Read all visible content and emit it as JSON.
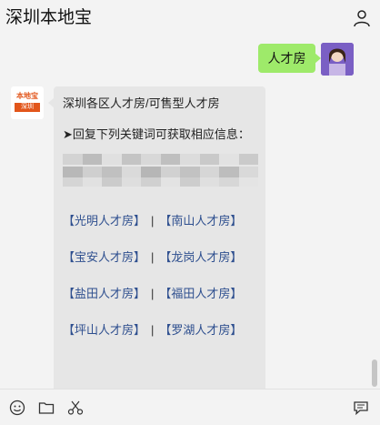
{
  "header": {
    "title": "深圳本地宝"
  },
  "outgoing": {
    "text": "人才房"
  },
  "incoming": {
    "avatar": {
      "logo_top": "本地宝",
      "logo_bottom": "深圳"
    },
    "heading": "深圳各区人才房/可售型人才房",
    "instruction": "➤回复下列关键词可获取相应信息：",
    "links": [
      {
        "left": "【光明人才房】",
        "sep": "|",
        "right": "【南山人才房】"
      },
      {
        "left": "【宝安人才房】",
        "sep": "|",
        "right": "【龙岗人才房】"
      },
      {
        "left": "【盐田人才房】",
        "sep": "|",
        "right": "【福田人才房】"
      },
      {
        "left": "【坪山人才房】",
        "sep": "|",
        "right": "【罗湖人才房】"
      }
    ]
  },
  "toolbar": {
    "icons": [
      "emoji-icon",
      "folder-icon",
      "scissors-icon",
      "chat-history-icon"
    ]
  },
  "colors": {
    "bubble_out": "#9eea6a",
    "bubble_in": "#e6e6e6",
    "link": "#2e4f8f",
    "logo": "#e2561b"
  }
}
